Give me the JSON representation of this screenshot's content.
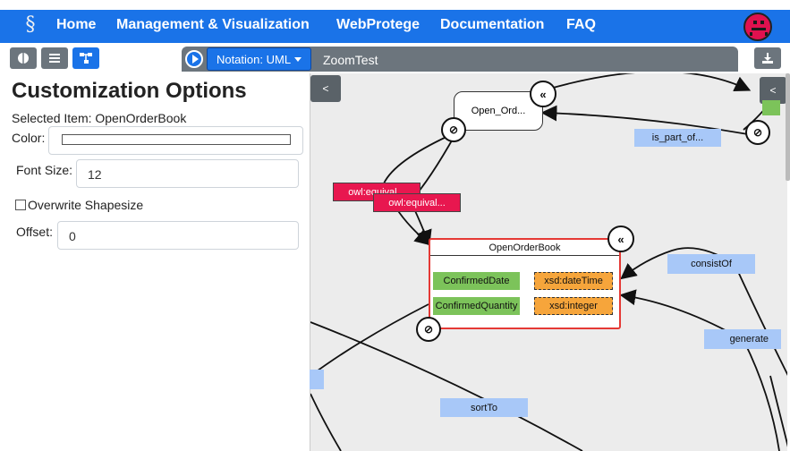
{
  "nav": {
    "links": [
      "Home",
      "Management & Visualization",
      "WebProtege",
      "Documentation",
      "FAQ"
    ]
  },
  "toolbar": {
    "notation_label": "Notation: UML",
    "graph_title": "ZoomTest"
  },
  "panel": {
    "title": "Customization Options",
    "selected_item": "Selected Item: OpenOrderBook",
    "color_label": "Color:",
    "font_size_label": "Font Size:",
    "font_size_value": "12",
    "overwrite_label": "Overwrite Shapesize",
    "offset_label": "Offset:",
    "offset_value": "0"
  },
  "canvas": {
    "collapse_left": "<",
    "collapse_right": "<",
    "open_ord_node": "Open_Ord...",
    "is_part_of_label": "is_part_of...",
    "equiv_label_1": "owl:equival...",
    "equiv_label_2": "owl:equival...",
    "main_node": {
      "title": "OpenOrderBook",
      "attributes": [
        {
          "name": "ConfirmedDate",
          "type": "xsd:dateTime"
        },
        {
          "name": "ConfirmedQuantity",
          "type": "xsd:integer"
        }
      ]
    },
    "consist_of_label": "consistOf",
    "generate_label": "generate",
    "sort_to_label": "sortTo"
  },
  "colors": {
    "primary": "#1a73e8",
    "secondary": "#6c757d",
    "attribute": "#7cc35a",
    "datatype": "#f6a53b",
    "property": "#a8c8f8",
    "equivalence": "#e8174f",
    "selected_border": "#e53935"
  },
  "icons": [
    "logo-icon",
    "avatar-icon",
    "sidebar-toggle-icon",
    "list-icon",
    "graph-icon",
    "play-icon",
    "download-icon",
    "collapse-icon",
    "hide-icon"
  ]
}
